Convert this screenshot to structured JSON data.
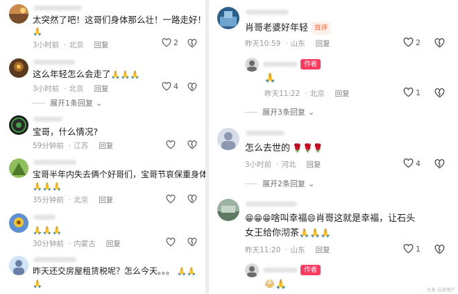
{
  "left": {
    "c1": {
      "text": "太突然了吧！这哥们身体那么壮！一路走好！",
      "line2": "🙏",
      "time": "3小时前",
      "loc": "北京",
      "reply": "回复",
      "likes": "2"
    },
    "c2": {
      "text": "这么年轻怎么会走了",
      "emoji": "🙏🙏🙏",
      "time": "3小时前",
      "loc": "北京",
      "reply": "回复",
      "likes": "4",
      "expand": "展开1条回复"
    },
    "c3": {
      "text": "宝哥，什么情况?",
      "time": "59分钟前",
      "loc": "江苏",
      "reply": "回复"
    },
    "c4": {
      "text": "宝哥半年内失去俩个好哥们，宝哥节哀保重身体",
      "line2": "🙏🙏🙏",
      "time": "35分钟前",
      "loc": "北京",
      "reply": "回复"
    },
    "c5": {
      "text": "🙏🙏🙏",
      "time": "30分钟前",
      "loc": "内蒙古",
      "reply": "回复"
    },
    "c6": {
      "text": "昨天还交房屋租赁税呢？怎么今天。。。",
      "emoji": "🙏🙏",
      "line2": "🙏"
    }
  },
  "right": {
    "r1": {
      "text": "肖哥老婆好年轻",
      "badge": "首评",
      "time": "昨天10:59",
      "loc": "山东",
      "reply": "回复",
      "likes": "2"
    },
    "r1reply": {
      "badge": "作者",
      "text": "🙏",
      "time": "昨天11:22",
      "loc": "北京",
      "reply": "回复",
      "likes": "1",
      "expand": "展开3条回复"
    },
    "r2": {
      "text": "怎么去世的",
      "emoji": "🌹🌹🌹",
      "time": "3小时前",
      "loc": "河北",
      "reply": "回复",
      "likes": "4",
      "expand": "展开2条回复"
    },
    "r3": {
      "prefix": "😁😁😁",
      "text1": "啥叫幸福",
      "mid": "😄",
      "text2": "肖哥这就是幸福，让石头",
      "line2": "女王给你沏茶",
      "line2emoji": "🙏🙏🙏",
      "time": "昨天11:20",
      "loc": "山东",
      "reply": "回复",
      "likes": "1"
    },
    "r3reply": {
      "badge": "作者",
      "text": "😂🙏"
    }
  },
  "watermark": "头条 @某用户",
  "colors": {
    "accent": "#ff3a5f",
    "hot": "#ff6a3d",
    "meta": "#9a9a9a"
  }
}
